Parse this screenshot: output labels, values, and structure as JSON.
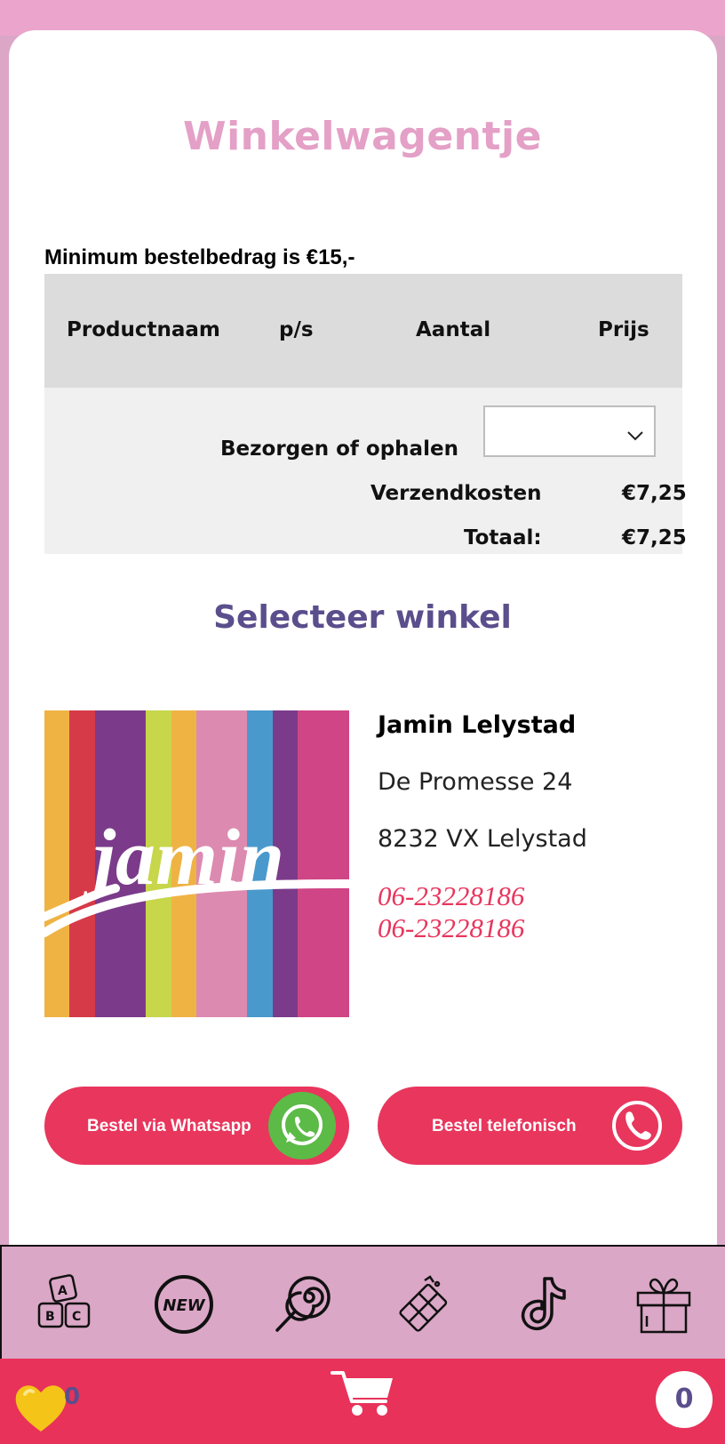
{
  "page": {
    "title": "Winkelwagentje",
    "min_order_notice": "Minimum bestelbedrag is €15,-"
  },
  "cart_table": {
    "columns": [
      "Productnaam",
      "p/s",
      "Aantal",
      "Prijs"
    ],
    "delivery_label": "Bezorgen of ophalen",
    "delivery_select_value": "",
    "shipping_label": "Verzendkosten",
    "shipping_value": "€7,25",
    "total_label": "Totaal:",
    "total_value": "€7,25"
  },
  "store_section": {
    "title": "Selecteer winkel",
    "logo_text": "jamin",
    "store": {
      "name": "Jamin Lelystad",
      "street": "De Promesse 24",
      "city": "8232 VX Lelystad",
      "phones": [
        "06-23228186",
        "06-23228186"
      ]
    }
  },
  "actions": {
    "whatsapp_label": "Bestel via Whatsapp",
    "phone_label": "Bestel telefonisch"
  },
  "bottom_nav": {
    "items": [
      {
        "icon": "abc-blocks-icon"
      },
      {
        "icon": "new-badge-icon",
        "text": "NEW"
      },
      {
        "icon": "lollipop-icon"
      },
      {
        "icon": "chocolate-icon"
      },
      {
        "icon": "tiktok-icon"
      },
      {
        "icon": "gift-icon"
      }
    ]
  },
  "footer": {
    "favorites_count": "0",
    "cart_count": "0"
  },
  "colors": {
    "primary": "#e8365d",
    "title_pink": "#e4a0c6",
    "section_purple": "#5b4e8c",
    "nav_bg": "#dba7c6"
  }
}
